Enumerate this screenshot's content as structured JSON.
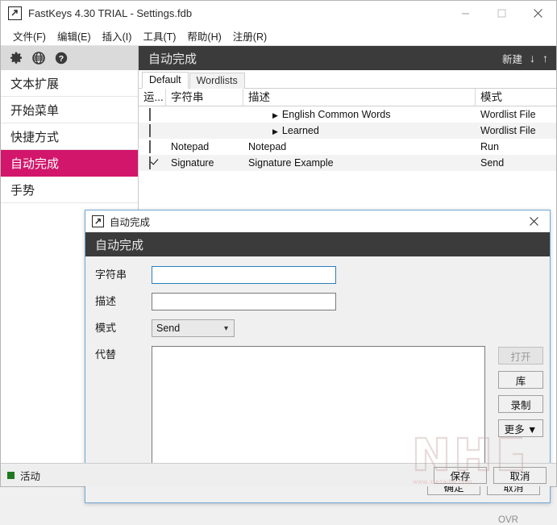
{
  "window": {
    "title": "FastKeys 4.30 TRIAL - Settings.fdb",
    "icon": "arrow-box-icon",
    "controls": {
      "minimize": "minimize-icon",
      "maximize": "maximize-icon",
      "close": "close-icon"
    }
  },
  "menubar": {
    "items": [
      {
        "label": "文件(F)"
      },
      {
        "label": "编辑(E)"
      },
      {
        "label": "插入(I)"
      },
      {
        "label": "工具(T)"
      },
      {
        "label": "帮助(H)"
      },
      {
        "label": "注册(R)"
      }
    ]
  },
  "sidebar": {
    "toolbar": [
      {
        "name": "gear-icon"
      },
      {
        "name": "globe-icon"
      },
      {
        "name": "help-icon"
      }
    ],
    "items": [
      {
        "label": "文本扩展",
        "selected": false
      },
      {
        "label": "开始菜单",
        "selected": false
      },
      {
        "label": "快捷方式",
        "selected": false
      },
      {
        "label": "自动完成",
        "selected": true
      },
      {
        "label": "手势",
        "selected": false
      }
    ],
    "selected_color": "#d2166b"
  },
  "main": {
    "header": {
      "title": "自动完成",
      "new_label": "新建",
      "down_arrow": "↓",
      "up_arrow": "↑"
    },
    "tabs": [
      {
        "label": "Default",
        "active": true
      },
      {
        "label": "Wordlists",
        "active": false
      }
    ],
    "table": {
      "columns": [
        "运...",
        "字符串",
        "描述",
        "模式"
      ],
      "rows": [
        {
          "checked": false,
          "string": "",
          "desc": "English Common Words",
          "expandable": true,
          "mode": "Wordlist File"
        },
        {
          "checked": false,
          "string": "",
          "desc": "Learned",
          "expandable": true,
          "mode": "Wordlist File"
        },
        {
          "checked": false,
          "string": "Notepad",
          "desc": "Notepad",
          "expandable": false,
          "mode": "Run"
        },
        {
          "checked": true,
          "string": "Signature",
          "desc": "Signature Example",
          "expandable": false,
          "mode": "Send"
        }
      ]
    }
  },
  "statusbar": {
    "status": "活动",
    "status_color": "#1f7a1f",
    "save_label": "保存",
    "cancel_label": "取消"
  },
  "dialog": {
    "icon": "arrow-box-icon",
    "title": "自动完成",
    "banner": "自动完成",
    "close_icon": "close-icon",
    "fields": {
      "string_label": "字符串",
      "string_value": "",
      "desc_label": "描述",
      "desc_value": "",
      "mode_label": "模式",
      "mode_value": "Send",
      "replace_label": "代替",
      "replace_value": ""
    },
    "side_buttons": [
      {
        "label": "打开",
        "disabled": true
      },
      {
        "label": "库",
        "disabled": false
      },
      {
        "label": "录制",
        "disabled": false
      },
      {
        "label": "更多 ▼",
        "disabled": false
      }
    ],
    "ovr": "OVR",
    "ok_label": "确定",
    "cancel_label": "取消"
  },
  "watermark": {
    "url": "www.xiazaiba.com"
  }
}
